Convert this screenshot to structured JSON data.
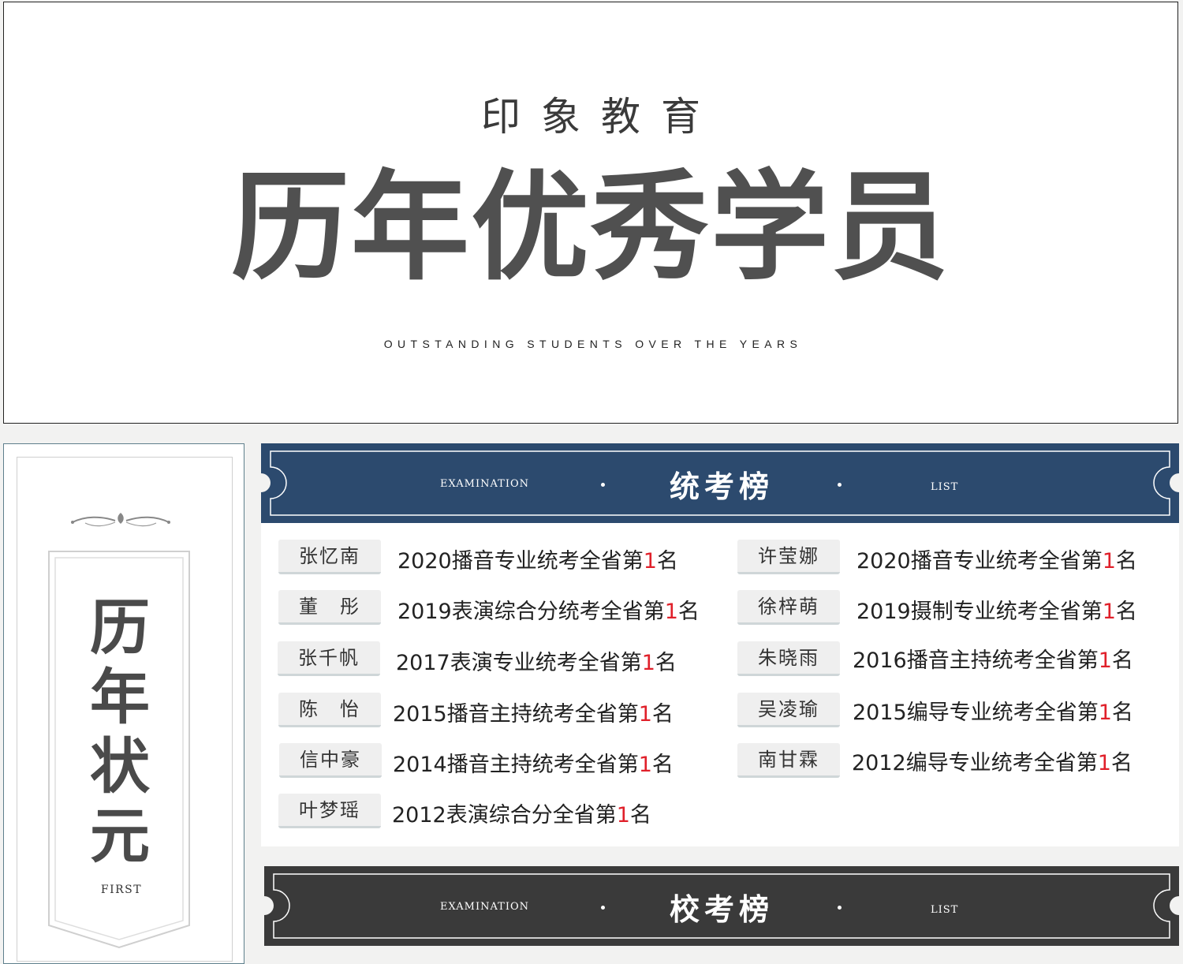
{
  "banner": {
    "brand": "印象教育",
    "headline": "历年优秀学员",
    "subline": "OUTSTANDING STUDENTS OVER THE YEARS"
  },
  "side_panel": {
    "title_chars": [
      "历",
      "年",
      "状",
      "元"
    ],
    "subtitle": "FIRST"
  },
  "unified_exam": {
    "left_label": "EXAMINATION",
    "title": "统考榜",
    "right_label": "LIST",
    "color": "#2c4a6e",
    "entries": [
      {
        "name": "张忆南",
        "pre": "2020播音专业统考全省第",
        "rank": "1",
        "post": "名"
      },
      {
        "name": "许莹娜",
        "pre": "2020播音专业统考全省第",
        "rank": "1",
        "post": "名"
      },
      {
        "name": "董　彤",
        "pre": "2019表演综合分统考全省第",
        "rank": "1",
        "post": "名"
      },
      {
        "name": "徐梓萌",
        "pre": "2019摄制专业统考全省第",
        "rank": "1",
        "post": "名"
      },
      {
        "name": "张千帆",
        "pre": "2017表演专业统考全省第",
        "rank": "1",
        "post": "名"
      },
      {
        "name": "朱晓雨",
        "pre": "2016播音主持统考全省第",
        "rank": "1",
        "post": "名"
      },
      {
        "name": "陈　怡",
        "pre": "2015播音主持统考全省第",
        "rank": "1",
        "post": "名"
      },
      {
        "name": "吴凌瑜",
        "pre": "2015编导专业统考全省第",
        "rank": "1",
        "post": "名"
      },
      {
        "name": "信中豪",
        "pre": "2014播音主持统考全省第",
        "rank": "1",
        "post": "名"
      },
      {
        "name": "南甘霖",
        "pre": "2012编导专业统考全省第",
        "rank": "1",
        "post": "名"
      },
      {
        "name": "叶梦瑶",
        "pre": "2012表演综合分全省第",
        "rank": "1",
        "post": "名"
      }
    ]
  },
  "school_exam": {
    "left_label": "EXAMINATION",
    "title": "校考榜",
    "right_label": "LIST",
    "color": "#3a3a3a"
  },
  "colors": {
    "rank_highlight": "#e0202a",
    "page_background": "#f2f2f1"
  }
}
